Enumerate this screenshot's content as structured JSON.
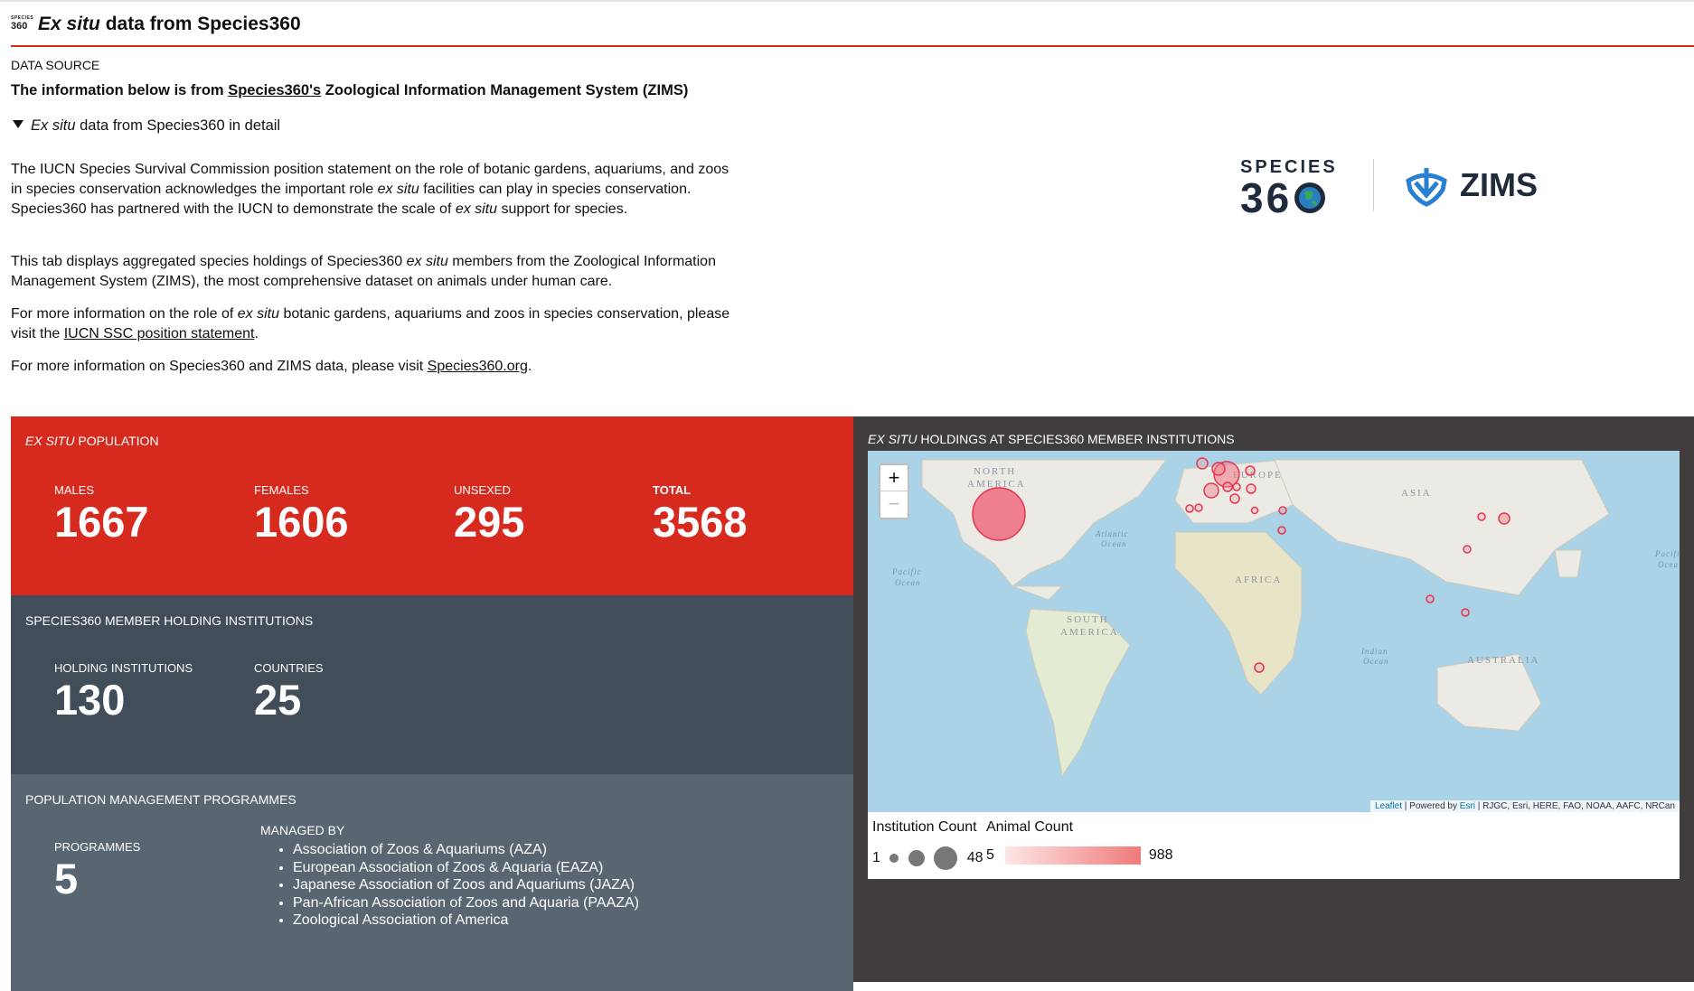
{
  "header": {
    "logo_small": "360",
    "logo_tiny": "SPECIES",
    "title_italic": "Ex situ",
    "title_rest": " data from Species360"
  },
  "data_source": {
    "label": "DATA SOURCE",
    "line_prefix": "The information below is from ",
    "line_link": "Species360's",
    "line_suffix": " Zoological Information Management System (ZIMS)"
  },
  "details": {
    "summary_italic": "Ex situ",
    "summary_rest": " data from Species360 in detail"
  },
  "paragraphs": {
    "p1_a": "The IUCN Species Survival Commission position statement on the role of botanic gardens, aquariums, and zoos in species conservation acknowledges the important role ",
    "p1_b": "ex situ",
    "p1_c": " facilities can play in species conservation. Species360 has partnered with the IUCN to demonstrate the scale of ",
    "p1_d": "ex situ",
    "p1_e": " support for species.",
    "p2_a": "This tab displays aggregated species holdings of Species360 ",
    "p2_b": "ex situ",
    "p2_c": " members from the Zoological Information Management System (ZIMS), the most comprehensive dataset on animals under human care.",
    "p3_a": "For more information on the role of ",
    "p3_b": "ex situ",
    "p3_c": " botanic gardens, aquariums and zoos in species conservation, please visit the ",
    "p3_link": "IUCN SSC position statement",
    "p3_d": ".",
    "p4_a": "For more information on Species360 and ZIMS data, please visit ",
    "p4_link": "Species360.org",
    "p4_b": "."
  },
  "brand": {
    "species": "SPECIES",
    "num": "36",
    "zims": "ZIMS"
  },
  "population": {
    "title_italic": "EX SITU",
    "title_rest": " POPULATION",
    "males_label": "MALES",
    "males": "1667",
    "females_label": "FEMALES",
    "females": "1606",
    "unsexed_label": "UNSEXED",
    "unsexed": "295",
    "total_label": "TOTAL",
    "total": "3568"
  },
  "institutions": {
    "title": "SPECIES360 MEMBER HOLDING INSTITUTIONS",
    "holding_label": "HOLDING INSTITUTIONS",
    "holding": "130",
    "countries_label": "COUNTRIES",
    "countries": "25"
  },
  "programmes": {
    "title": "POPULATION MANAGEMENT PROGRAMMES",
    "programmes_label": "PROGRAMMES",
    "programmes": "5",
    "managed_label": "MANAGED BY",
    "managed": [
      "Association of Zoos & Aquariums (AZA)",
      "European Association of Zoos & Aquaria (EAZA)",
      "Japanese Association of Zoos and Aquariums (JAZA)",
      "Pan-African Association of Zoos and Aquaria (PAAZA)",
      "Zoological Association of America"
    ]
  },
  "map": {
    "title_italic": "EX SITU",
    "title_rest": " HOLDINGS AT SPECIES360 MEMBER INSTITUTIONS",
    "zoom_in": "+",
    "zoom_out": "−",
    "labels": {
      "north_america_1": "NORTH",
      "north_america_2": "AMERICA",
      "europe": "EUROPE",
      "asia": "ASIA",
      "africa": "AFRICA",
      "south_america_1": "SOUTH",
      "south_america_2": "AMERICA",
      "australia": "AUSTRALIA",
      "atlantic_1": "Atlantic",
      "atlantic_2": "Ocean",
      "pacific_1": "Pacific",
      "pacific_2": "Ocean",
      "pacific_e1": "Pacifi",
      "pacific_e2": "Ocea",
      "indian_1": "Indian",
      "indian_2": "Ocean"
    },
    "attribution_leaflet": "Leaflet",
    "attribution_powered": " | Powered by ",
    "attribution_esri": "Esri",
    "attribution_rest": " | RJGC, Esri, HERE, FAO, NOAA, AAFC, NRCan",
    "marker_color": "#e8344f"
  },
  "legend": {
    "institution_title": "Institution Count",
    "inst_min": "1",
    "inst_max": "48",
    "animal_title": "Animal Count",
    "animal_min": "5",
    "animal_max": "988"
  }
}
